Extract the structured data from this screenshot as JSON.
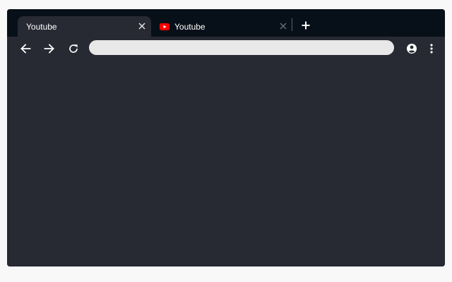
{
  "tabs": [
    {
      "title": "Youtube",
      "active": true,
      "favicon": null
    },
    {
      "title": "Youtube",
      "active": false,
      "favicon": "youtube-icon"
    }
  ],
  "icons": {
    "close": "close-icon",
    "new_tab": "plus-icon",
    "back": "arrow-left-icon",
    "forward": "arrow-right-icon",
    "reload": "reload-icon",
    "profile": "account-circle-icon",
    "menu": "more-vertical-icon"
  },
  "omnibox": {
    "value": "",
    "placeholder": ""
  },
  "colors": {
    "tabstrip": "#071018",
    "frame": "#272a33",
    "omnibox": "#e8e8e8",
    "youtube_red": "#ff0000"
  }
}
